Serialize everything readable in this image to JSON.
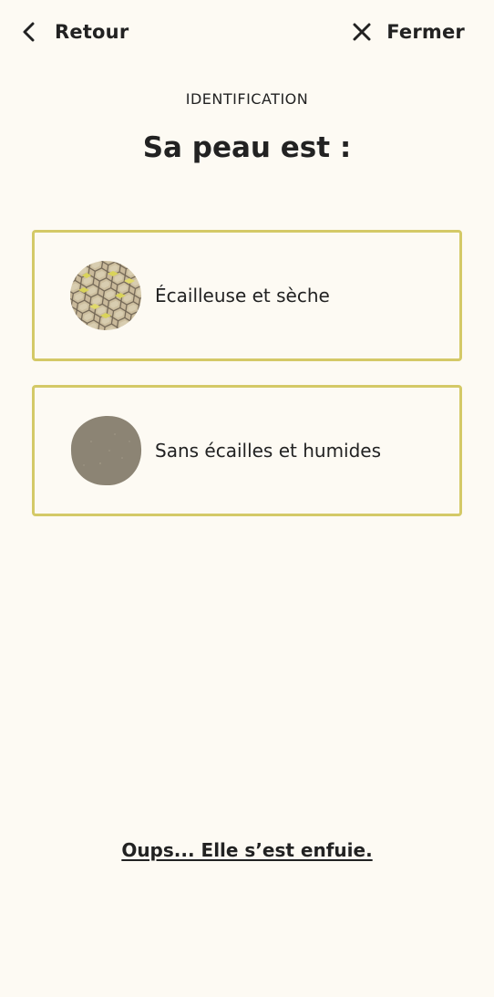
{
  "nav": {
    "back_label": "Retour",
    "back_icon": "chevron-left-icon",
    "close_label": "Fermer",
    "close_icon": "close-icon"
  },
  "section_label": "IDENTIFICATION",
  "question": "Sa peau est :",
  "options": [
    {
      "label": "Écailleuse et sèche",
      "icon": "scaly-skin-icon"
    },
    {
      "label": "Sans écailles et humides",
      "icon": "smooth-skin-icon"
    }
  ],
  "escape_link": "Oups... Elle s’est enfuie.",
  "colors": {
    "background": "#fdfaf3",
    "option_border": "#d4c967",
    "text": "#222222",
    "scale_base": "#c9b99a",
    "scale_accent": "#d9d35a",
    "smooth_skin": "#8c8474"
  }
}
